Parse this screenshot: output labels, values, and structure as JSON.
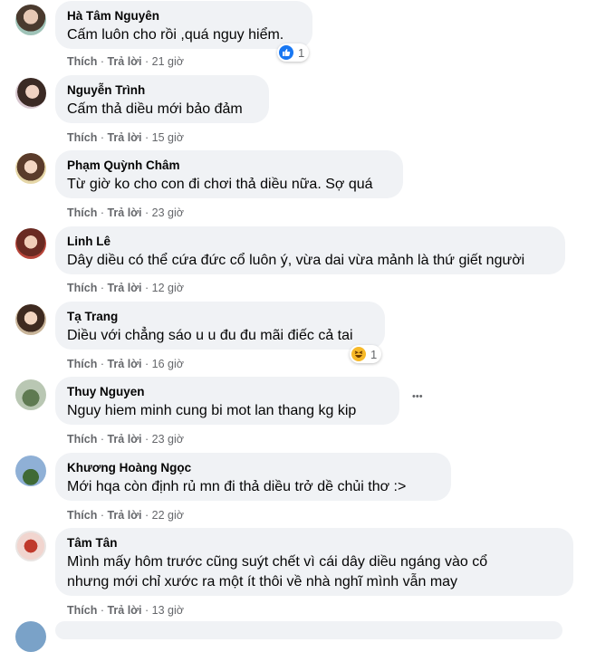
{
  "comments": [
    {
      "name": "Hà Tâm Nguyên",
      "text": "Cấm luôn cho rồi ,quá nguy hiểm.",
      "like": "Thích",
      "reply": "Trả lời",
      "time": "21 giờ",
      "reaction": {
        "type": "like-icon",
        "count": "1"
      }
    },
    {
      "name": "Nguyễn Trình",
      "text": "Cấm thả diều mới bảo đảm",
      "like": "Thích",
      "reply": "Trả lời",
      "time": "15 giờ"
    },
    {
      "name": "Phạm Quỳnh Châm",
      "text": "Từ giờ ko cho con đi chơi thả diều nữa. Sợ quá",
      "like": "Thích",
      "reply": "Trả lời",
      "time": "23 giờ"
    },
    {
      "name": "Linh Lê",
      "text": "Dây diều có thể cứa đức cổ luôn ý, vừa dai vừa mảnh là thứ giết người",
      "like": "Thích",
      "reply": "Trả lời",
      "time": "12 giờ"
    },
    {
      "name": "Tạ Trang",
      "text": "Diều với chẳng sáo u u đu đu mãi điếc cả tai",
      "like": "Thích",
      "reply": "Trả lời",
      "time": "16 giờ",
      "reaction": {
        "type": "haha-icon",
        "count": "1"
      }
    },
    {
      "name": "Thuy Nguyen",
      "text": "Nguy hiem minh cung bi mot lan thang kg kip",
      "like": "Thích",
      "reply": "Trả lời",
      "time": "23 giờ",
      "more": "•••"
    },
    {
      "name": "Khương Hoàng Ngọc",
      "text": "Mới hqa còn định rủ mn đi thả diều trở dề chủi thơ :>",
      "like": "Thích",
      "reply": "Trả lời",
      "time": "22 giờ"
    },
    {
      "name": "Tâm Tân",
      "text_lines": [
        "Mình mấy hôm trước cũng suýt chết vì cái dây diều ngáng vào cổ",
        "nhưng mới chỉ xước ra một ít thôi về nhà nghĩ mình vẫn may"
      ],
      "like": "Thích",
      "reply": "Trả lời",
      "time": "13 giờ"
    }
  ],
  "separator": " · ",
  "colors": {
    "bubble": "#f0f2f5",
    "meta": "#65676b",
    "like_blue": "#1877f2",
    "haha_yellow": "#f7b928"
  }
}
